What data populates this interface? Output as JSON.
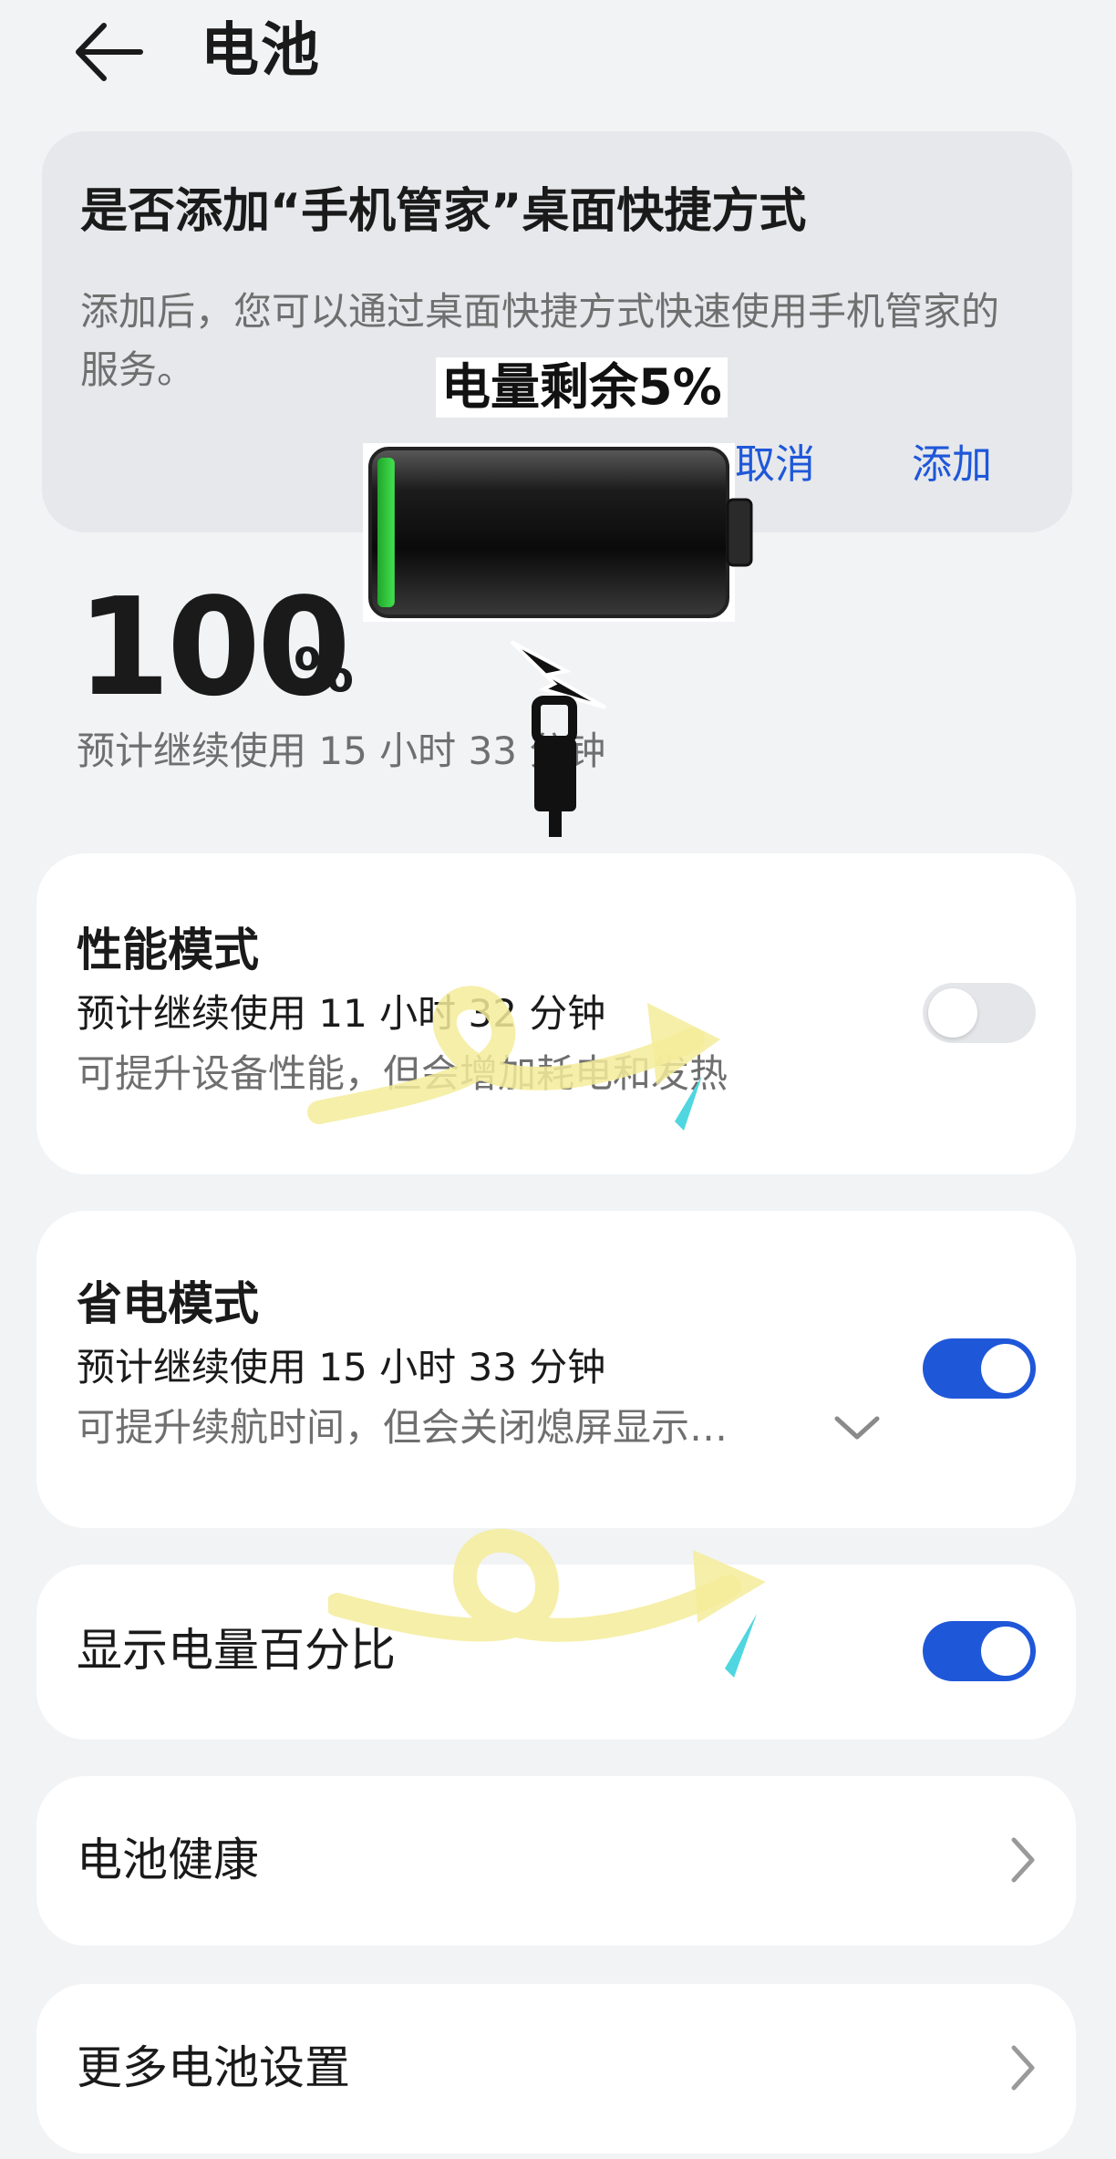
{
  "header": {
    "title": "电池"
  },
  "dialog": {
    "title": "是否添加“手机管家”桌面快捷方式",
    "description": "添加后，您可以通过桌面快捷方式快速使用手机管家的服务。",
    "cancel_label": "取消",
    "add_label": "添加"
  },
  "overlay": {
    "text": "电量剩余5%",
    "level_percent": 5,
    "level_color": "#2ecc40"
  },
  "battery": {
    "percent": "100",
    "percent_sign": "%",
    "estimate": "预计继续使用 15 小时 33 分钟"
  },
  "performance_mode": {
    "title": "性能模式",
    "estimate": "预计继续使用 11 小时 32 分钟",
    "description": "可提升设备性能，但会增加耗电和发热",
    "enabled": false
  },
  "power_saving_mode": {
    "title": "省电模式",
    "estimate": "预计继续使用 15 小时 33 分钟",
    "description": "可提升续航时间，但会关闭熄屏显示…",
    "enabled": true
  },
  "show_percentage": {
    "title": "显示电量百分比",
    "enabled": true
  },
  "battery_health": {
    "title": "电池健康"
  },
  "more_settings": {
    "title": "更多电池设置"
  },
  "colors": {
    "accent": "#1f57d9",
    "background": "#f1f3f5",
    "card": "#ffffff",
    "annotation_yellow": "#f5ec9a",
    "annotation_cyan": "#4fd6e0"
  }
}
